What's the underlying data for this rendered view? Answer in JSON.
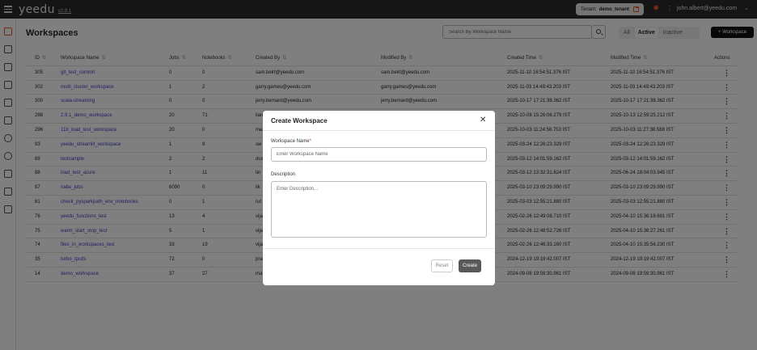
{
  "app": {
    "logo": "yeedu",
    "version": "v2.9.1"
  },
  "topbar": {
    "tenant_label": "Tenant:",
    "tenant_value": "demo_tenant",
    "user_email": "john.albert@yeedu.com"
  },
  "sidebar": {
    "icons": [
      "workspaces-icon",
      "clusters-icon",
      "jobs-icon",
      "notebooks-icon",
      "files-icon",
      "compute-icon",
      "cloud-icon",
      "settings-icon",
      "security-icon",
      "database-icon",
      "docs-icon"
    ],
    "active": "workspaces-icon"
  },
  "page": {
    "title": "Workspaces",
    "search_placeholder": "Search By Workspace Name",
    "filters": [
      "All",
      "Active",
      "Inactive"
    ],
    "active_filter": "Active",
    "add_button": "+ Workspace"
  },
  "table": {
    "columns": [
      "ID",
      "Workspace Name",
      "Jobs",
      "Notebooks",
      "Created By",
      "Modified By",
      "Created Time",
      "Modified Time",
      "Actions"
    ],
    "rows": [
      [
        "305",
        "git_test_commit",
        "0",
        "0",
        "sam.belrt@yeedu.com",
        "sam.belrt@yeedu.com",
        "2025-11-10 16:54:51.376 IST",
        "2025-11-10 16:54:51.376 IST"
      ],
      [
        "302",
        "multi_cluster_workspace",
        "1",
        "2",
        "garry.games@yeedu.com",
        "garry.games@yeedu.com",
        "2025-11-03 14:49:43.203 IST",
        "2025-11-03 14:49:43.203 IST"
      ],
      [
        "300",
        "scala-streaming",
        "0",
        "0",
        "jerry.bernard@yeedu.com",
        "jerry.bernard@yeedu.com",
        "2025-10-17 17:21:38.362 IST",
        "2025-10-17 17:21:38.362 IST"
      ],
      [
        "298",
        "2.9.1_demo_workspace",
        "20",
        "71",
        "liam",
        "",
        "2025-10-08 15:26:06.279 IST",
        "2025-10-13 12:59:25.212 IST"
      ],
      [
        "296",
        "11b_load_test_workspace",
        "20",
        "0",
        "ma",
        "",
        "2025-10-03 11:24:58.753 IST",
        "2025-10-03 11:27:38.588 IST"
      ],
      [
        "93",
        "yeedu_streamlit_workspace",
        "1",
        "9",
        "sw",
        "",
        "2025-03-24 12:26:23.329 IST",
        "2025-03-24 12:26:23.329 IST"
      ],
      [
        "89",
        "testsample",
        "2",
        "2",
        "dus",
        "",
        "2025-03-12 14:01:59.162 IST",
        "2025-03-12 14:01:59.162 IST"
      ],
      [
        "88",
        "load_test_azure",
        "1",
        "11",
        "tin",
        "",
        "2025-03-12 13:32:31.624 IST",
        "2025-06-24 18:04:03.945 IST"
      ],
      [
        "87",
        "nabu_jobs",
        "6090",
        "0",
        "lik",
        "",
        "2025-03-10 23:09:29.990 IST",
        "2025-03-10 23:09:29.990 IST"
      ],
      [
        "81",
        "check_pysparkpath_env_notebooks",
        "0",
        "1",
        "rut",
        "",
        "2025-03-03 12:55:21.880 IST",
        "2025-03-03 12:55:21.880 IST"
      ],
      [
        "76",
        "yeedu_functions_test",
        "13",
        "4",
        "vija",
        "",
        "2025-02-26 12:49:08.710 IST",
        "2025-04-10 15:36:18.681 IST"
      ],
      [
        "75",
        "warm_start_stop_test",
        "5",
        "1",
        "vija",
        "",
        "2025-02-26 12:48:52.726 IST",
        "2025-04-10 15:36:27.261 IST"
      ],
      [
        "74",
        "files_in_workspaces_test",
        "33",
        "19",
        "vija",
        "",
        "2025-02-26 12:46:33.160 IST",
        "2025-04-10 15:35:56.230 IST"
      ],
      [
        "35",
        "turbo_tpcds",
        "72",
        "0",
        "pra",
        "",
        "2024-12-19 19:19:42.007 IST",
        "2024-12-19 19:19:42.007 IST"
      ],
      [
        "14",
        "demo_workspace",
        "37",
        "27",
        "ma",
        "",
        "2024-09-06 19:59:30.961 IST",
        "2024-09-06 19:59:30.961 IST"
      ]
    ]
  },
  "modal": {
    "title": "Create Workspace",
    "name_label": "Workspace Name",
    "required_mark": "*",
    "name_placeholder": "Enter Workspace Name",
    "desc_label": "Description",
    "desc_placeholder": "Enter Description...",
    "reset_label": "Reset",
    "create_label": "Create"
  }
}
